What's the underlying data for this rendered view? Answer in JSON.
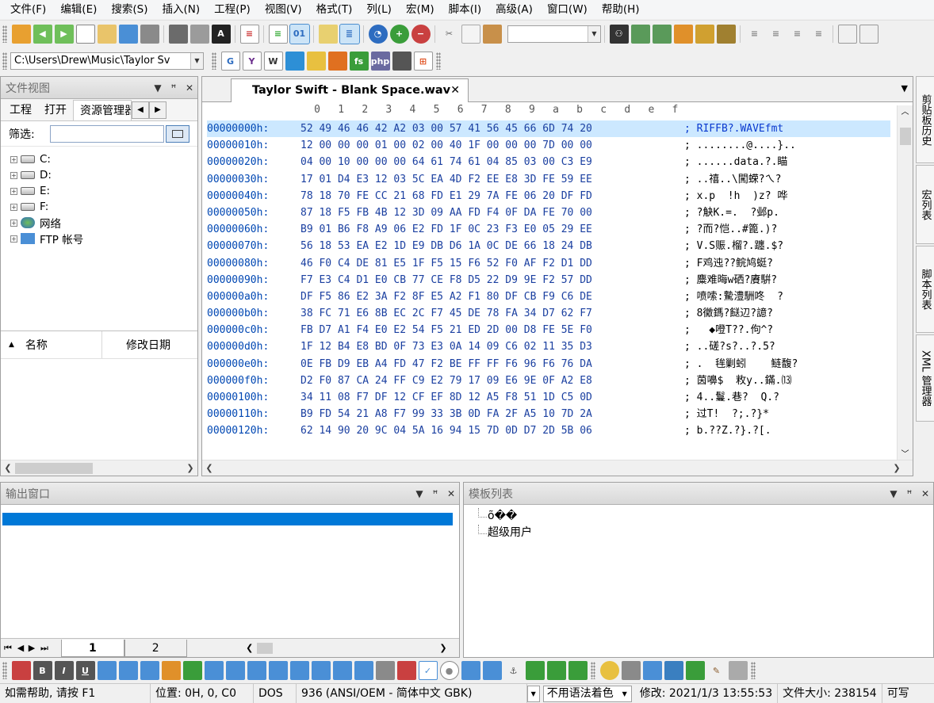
{
  "menu": [
    "文件(F)",
    "编辑(E)",
    "搜索(S)",
    "插入(N)",
    "工程(P)",
    "视图(V)",
    "格式(T)",
    "列(L)",
    "宏(M)",
    "脚本(I)",
    "高级(A)",
    "窗口(W)",
    "帮助(H)"
  ],
  "toolbar": {
    "path_combo": "C:\\Users\\Drew\\Music\\Taylor Sv",
    "search_combo": "",
    "colors": {
      "blue": "#2d6cc0",
      "green": "#3a9d3a",
      "red": "#c94040",
      "orange": "#e0902a",
      "gray": "#7a7a7a"
    }
  },
  "left_panel": {
    "title": "文件视图",
    "controls": [
      "▼",
      "ꟸ",
      "✕"
    ],
    "tabs": [
      "工程",
      "打开",
      "资源管理器"
    ],
    "filter_label": "筛选:",
    "tree": [
      "C:",
      "D:",
      "E:",
      "F:",
      "网络",
      "FTP 帐号"
    ],
    "columns": [
      "名称",
      "修改日期"
    ]
  },
  "editor": {
    "tab_title": "Taylor Swift - Blank Space.wav",
    "ruler": [
      "0",
      "1",
      "2",
      "3",
      "4",
      "5",
      "6",
      "7",
      "8",
      "9",
      "a",
      "b",
      "c",
      "d",
      "e",
      "f"
    ],
    "rows": [
      {
        "offset": "00000000h:",
        "bytes": "52 49 46 46 42 A2 03 00 57 41 56 45 66 6D 74 20",
        "ascii": "RIFFB?.WAVEfmt"
      },
      {
        "offset": "00000010h:",
        "bytes": "12 00 00 00 01 00 02 00 40 1F 00 00 00 7D 00 00",
        "ascii": "........@....}.."
      },
      {
        "offset": "00000020h:",
        "bytes": "04 00 10 00 00 00 64 61 74 61 04 85 03 00 C3 E9",
        "ascii": "......data.?.瞄"
      },
      {
        "offset": "00000030h:",
        "bytes": "17 01 D4 E3 12 03 5C EA 4D F2 EE E8 3D FE 59 EE",
        "ascii": "..禧..\\闖蝾?ㄟ?"
      },
      {
        "offset": "00000040h:",
        "bytes": "78 18 70 FE CC 21 68 FD E1 29 7A FE 06 20 DF FD",
        "ascii": "x.p  !h  )z? 哗"
      },
      {
        "offset": "00000050h:",
        "bytes": "87 18 F5 FB 4B 12 3D 09 AA FD F4 0F DA FE 70 00",
        "ascii": "?觖K.=.  ?邺p."
      },
      {
        "offset": "00000060h:",
        "bytes": "B9 01 B6 F8 A9 06 E2 FD 1F 0C 23 F3 E0 05 29 EE",
        "ascii": "?而?恺..#篦.)?"
      },
      {
        "offset": "00000070h:",
        "bytes": "56 18 53 EA E2 1D E9 DB D6 1A 0C DE 66 18 24 DB",
        "ascii": "V.S赈.榴?.躔.$?"
      },
      {
        "offset": "00000080h:",
        "bytes": "46 F0 C4 DE 81 E5 1F F5 15 F6 52 F0 AF F2 D1 DD",
        "ascii": "F鸡迍??鲩鸠蜓?"
      },
      {
        "offset": "00000090h:",
        "bytes": "F7 E3 C4 D1 E0 CB 77 CE F8 D5 22 D9 9E F2 57 DD",
        "ascii": "麋难晦w硒?賡騈?"
      },
      {
        "offset": "000000a0h:",
        "bytes": "DF F5 86 E2 3A F2 8F E5 A2 F1 80 DF CB F9 C6 DE",
        "ascii": "喷嗦:驇澧駲咚  ?"
      },
      {
        "offset": "000000b0h:",
        "bytes": "38 FC 71 E6 8B EC 2C F7 45 DE 78 FA 34 D7 62 F7",
        "ascii": "8黴鎷?餸辺?譩?"
      },
      {
        "offset": "000000c0h:",
        "bytes": "FB D7 A1 F4 E0 E2 54 F5 21 ED 2D 00 D8 FE 5E F0",
        "ascii": "  ◆噔T??.佝^?"
      },
      {
        "offset": "000000d0h:",
        "bytes": "1F 12 B4 E8 BD 0F 73 E3 0A 14 09 C6 02 11 35 D3",
        "ascii": "..磋?s?..?.5?"
      },
      {
        "offset": "000000e0h:",
        "bytes": "0E FB D9 EB A4 FD 47 F2 BE FF FF F6 96 F6 76 DA",
        "ascii": ".  毪剿蚓    鲢馥?"
      },
      {
        "offset": "000000f0h:",
        "bytes": "D2 F0 87 CA 24 FF C9 E2 79 17 09 E6 9E 0F A2 E8",
        "ascii": "茵嚊$  敉y..鏋.⒀"
      },
      {
        "offset": "00000100h:",
        "bytes": "34 11 08 F7 DF 12 CF EF 8D 12 A5 F8 51 1D C5 0D",
        "ascii": "4..鬘.巷?  Q.?"
      },
      {
        "offset": "00000110h:",
        "bytes": "B9 FD 54 21 A8 F7 99 33 3B 0D FA 2F A5 10 7D 2A",
        "ascii": "过T!  ?;.?}*"
      },
      {
        "offset": "00000120h:",
        "bytes": "62 14 90 20 9C 04 5A 16 94 15 7D 0D D7 2D 5B 06",
        "ascii": "b.??Z.?}.?[."
      }
    ]
  },
  "right_tabs": [
    "剪贴板历史",
    "宏列表",
    "脚本列表",
    "XML 管理器"
  ],
  "output_panel": {
    "title": "输出窗口",
    "tabs": [
      "1",
      "2"
    ]
  },
  "template_panel": {
    "title": "模板列表",
    "items": [
      "õ��",
      "超级用户"
    ]
  },
  "status": {
    "help": "如需帮助, 请按 F1",
    "position": "位置: 0H, 0, C0",
    "line_ending": "DOS",
    "codepage": "936",
    "encoding": "(ANSI/OEM - 简体中文 GBK)",
    "syntax": "不用语法着色",
    "modified": "修改: 2021/1/3 13:55:53",
    "file_size": "文件大小: 238154",
    "mode": "可写"
  }
}
